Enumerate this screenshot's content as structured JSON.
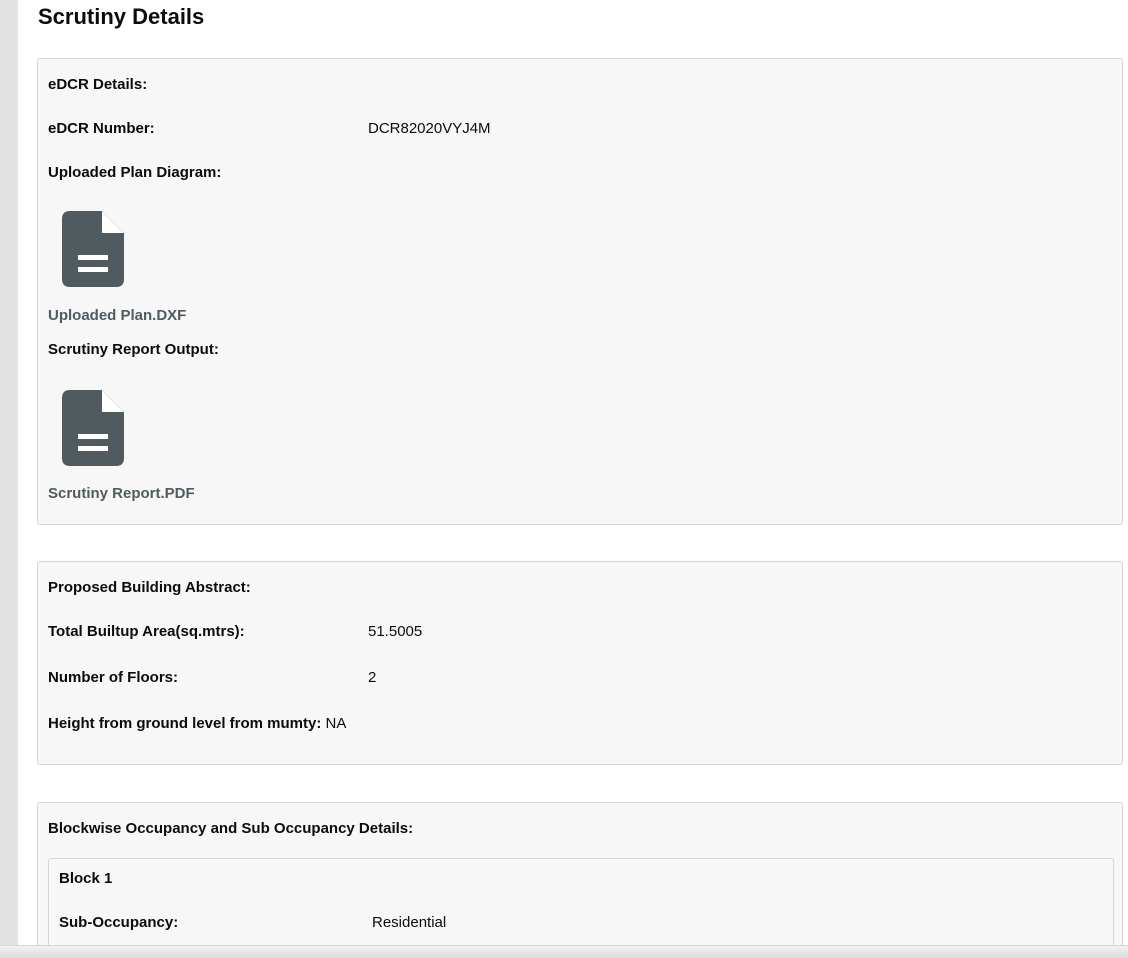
{
  "page": {
    "title": "Scrutiny Details"
  },
  "edcr": {
    "heading": "eDCR Details:",
    "number_label": "eDCR Number:",
    "number_value": "DCR82020VYJ4M",
    "plan_label": "Uploaded Plan Diagram:",
    "plan_file": "Uploaded Plan.DXF",
    "report_label": "Scrutiny Report Output:",
    "report_file": "Scrutiny Report.PDF",
    "icon": "document-icon"
  },
  "abstract": {
    "heading": "Proposed Building Abstract:",
    "area_label": "Total Builtup Area(sq.mtrs):",
    "area_value": "51.5005",
    "floors_label": "Number of Floors:",
    "floors_value": "2",
    "height_label": "Height from ground level from mumty:",
    "height_value": "NA"
  },
  "blockwise": {
    "heading": "Blockwise Occupancy and Sub Occupancy Details:",
    "blocks": [
      {
        "title": "Block 1",
        "sub_occupancy_label": "Sub-Occupancy:",
        "sub_occupancy_value": "Residential"
      }
    ]
  },
  "colors": {
    "card_bg": "#f7f7f7",
    "card_border": "#d6d6d6",
    "icon": "#505a5f",
    "link": "#505a5f"
  }
}
